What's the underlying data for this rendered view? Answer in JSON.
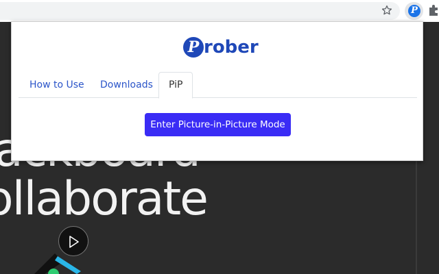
{
  "browser": {
    "star_icon": "star-outline-icon",
    "extension_icon": "prober-extension-icon",
    "extension_letter": "P",
    "puzzle_icon": "puzzle-extensions-icon"
  },
  "background_page": {
    "line1": "ackboard",
    "line2": "ollaborate",
    "play_icon": "play-icon"
  },
  "popup": {
    "brand": {
      "logo_letter": "P",
      "name": "rober",
      "color": "#1f48b8"
    },
    "tabs": [
      {
        "label": "How to Use",
        "active": false
      },
      {
        "label": "Downloads",
        "active": false
      },
      {
        "label": "PiP",
        "active": true
      }
    ],
    "pip_button_label": "Enter Picture-in-Picture Mode",
    "accent_color": "#3a2cf5"
  }
}
